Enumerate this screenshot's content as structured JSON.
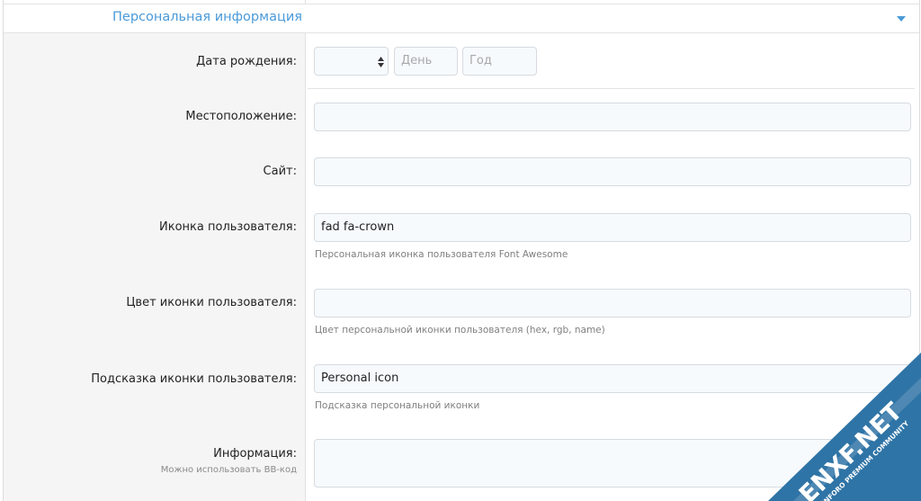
{
  "section": {
    "title": "Персональная информация"
  },
  "fields": {
    "dob": {
      "label": "Дата рождения:",
      "day_placeholder": "День",
      "year_placeholder": "Год",
      "month_value": ""
    },
    "location": {
      "label": "Местоположение:",
      "value": ""
    },
    "website": {
      "label": "Сайт:",
      "value": ""
    },
    "user_icon": {
      "label": "Иконка пользователя:",
      "value": "fad fa-crown",
      "hint": "Персональная иконка пользователя Font Awesome"
    },
    "user_icon_color": {
      "label": "Цвет иконки пользователя:",
      "value": "",
      "hint": "Цвет персональной иконки пользователя (hex, rgb, name)"
    },
    "user_icon_tooltip": {
      "label": "Подсказка иконки пользователя:",
      "value": "Personal icon",
      "hint": "Подсказка персональной иконки"
    },
    "about": {
      "label": "Информация:",
      "sublabel": "Можно использовать BB-код",
      "value": ""
    }
  },
  "watermark": {
    "brand": "ENXF.NET",
    "tagline": "XENFORO PREMIUM COMMUNITY"
  },
  "colors": {
    "accent": "#4a9ad8",
    "panel": "#f5f5f5",
    "input_bg": "#f7fafd",
    "watermark_blue": "#2f74a6"
  }
}
